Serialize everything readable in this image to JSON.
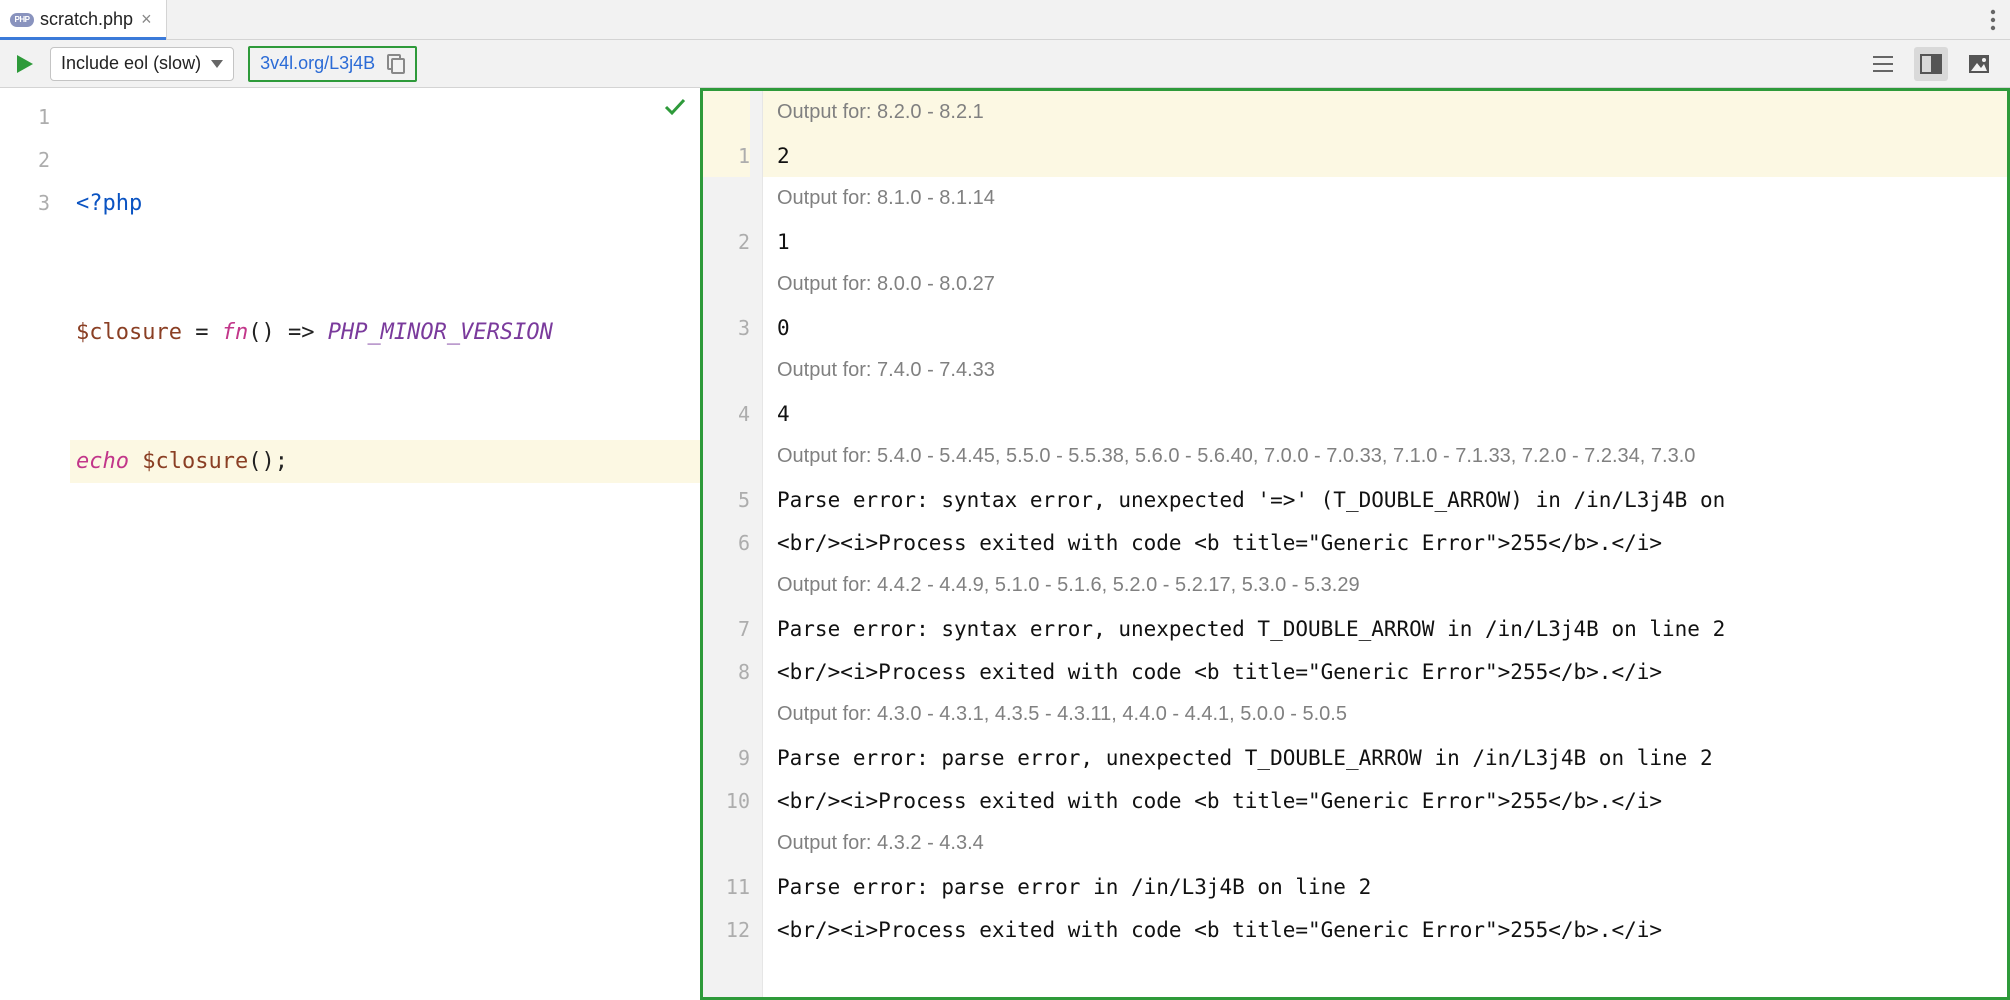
{
  "tab": {
    "filename": "scratch.php"
  },
  "toolbar": {
    "dropdown_label": "Include eol (slow)",
    "share_url": "3v4l.org/L3j4B"
  },
  "editor": {
    "lines": [
      "1",
      "2",
      "3"
    ],
    "code": {
      "l1_tag": "<?php",
      "l2_var": "$closure",
      "l2_eq": " = ",
      "l2_fn": "fn",
      "l2_par": "() => ",
      "l2_const": "PHP_MINOR_VERSION",
      "l3_echo": "echo",
      "l3_sp": " ",
      "l3_var": "$closure",
      "l3_tail": "();"
    }
  },
  "output": {
    "rows": [
      {
        "kind": "hdr",
        "ln": "",
        "text": "Output for: 8.2.0 - 8.2.1",
        "hl": true
      },
      {
        "kind": "mono",
        "ln": "1",
        "text": "2",
        "hl": true
      },
      {
        "kind": "hdr",
        "ln": "",
        "text": "Output for: 8.1.0 - 8.1.14"
      },
      {
        "kind": "mono",
        "ln": "2",
        "text": "1"
      },
      {
        "kind": "hdr",
        "ln": "",
        "text": "Output for: 8.0.0 - 8.0.27"
      },
      {
        "kind": "mono",
        "ln": "3",
        "text": "0"
      },
      {
        "kind": "hdr",
        "ln": "",
        "text": "Output for: 7.4.0 - 7.4.33"
      },
      {
        "kind": "mono",
        "ln": "4",
        "text": "4"
      },
      {
        "kind": "hdr",
        "ln": "",
        "text": "Output for: 5.4.0 - 5.4.45, 5.5.0 - 5.5.38, 5.6.0 - 5.6.40, 7.0.0 - 7.0.33, 7.1.0 - 7.1.33, 7.2.0 - 7.2.34, 7.3.0"
      },
      {
        "kind": "mono",
        "ln": "5",
        "text": "Parse error: syntax error, unexpected '=>' (T_DOUBLE_ARROW) in /in/L3j4B on "
      },
      {
        "kind": "mono",
        "ln": "6",
        "text": "<br/><i>Process exited with code <b title=\"Generic Error\">255</b>.</i>"
      },
      {
        "kind": "hdr",
        "ln": "",
        "text": "Output for: 4.4.2 - 4.4.9, 5.1.0 - 5.1.6, 5.2.0 - 5.2.17, 5.3.0 - 5.3.29"
      },
      {
        "kind": "mono",
        "ln": "7",
        "text": "Parse error: syntax error, unexpected T_DOUBLE_ARROW in /in/L3j4B on line 2"
      },
      {
        "kind": "mono",
        "ln": "8",
        "text": "<br/><i>Process exited with code <b title=\"Generic Error\">255</b>.</i>"
      },
      {
        "kind": "hdr",
        "ln": "",
        "text": "Output for: 4.3.0 - 4.3.1, 4.3.5 - 4.3.11, 4.4.0 - 4.4.1, 5.0.0 - 5.0.5"
      },
      {
        "kind": "mono",
        "ln": "9",
        "text": "Parse error: parse error, unexpected T_DOUBLE_ARROW in /in/L3j4B on line 2"
      },
      {
        "kind": "mono",
        "ln": "10",
        "text": "<br/><i>Process exited with code <b title=\"Generic Error\">255</b>.</i>"
      },
      {
        "kind": "hdr",
        "ln": "",
        "text": "Output for: 4.3.2 - 4.3.4"
      },
      {
        "kind": "mono",
        "ln": "11",
        "text": "Parse error: parse error in /in/L3j4B on line 2"
      },
      {
        "kind": "mono",
        "ln": "12",
        "text": "<br/><i>Process exited with code <b title=\"Generic Error\">255</b>.</i>"
      }
    ]
  }
}
